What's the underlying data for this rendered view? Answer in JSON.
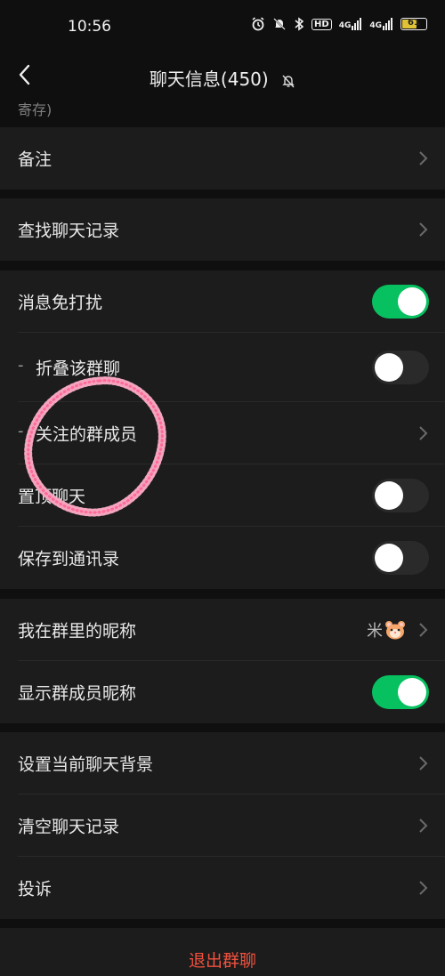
{
  "status": {
    "time": "10:56",
    "net1": "HD",
    "net2": "4G",
    "net3": "4G",
    "battery": "61"
  },
  "header": {
    "title": "聊天信息(450)"
  },
  "truncated_text": "寄存)",
  "rows": {
    "remark": "备注",
    "search": "查找聊天记录",
    "dnd": "消息免打扰",
    "fold": "折叠该群聊",
    "followed": "关注的群成员",
    "pin": "置顶聊天",
    "save": "保存到通讯录",
    "nickname": "我在群里的昵称",
    "nickname_value": "米",
    "show_nick": "显示群成员昵称",
    "background": "设置当前聊天背景",
    "clear": "清空聊天记录",
    "report": "投诉"
  },
  "exit_label": "退出群聊",
  "icons": {
    "back": "chevron-left-icon",
    "mute": "bell-off-icon",
    "chevron": "chevron-right-icon",
    "nick_emoji": "hamster-face-icon"
  },
  "toggles": {
    "dnd": true,
    "fold": false,
    "pin": false,
    "save": false,
    "show_nick": true
  },
  "colors": {
    "accent_green": "#07c160",
    "danger_red": "#f0513e",
    "row_bg": "#1c1c1c",
    "page_bg": "#0f0f0f"
  }
}
